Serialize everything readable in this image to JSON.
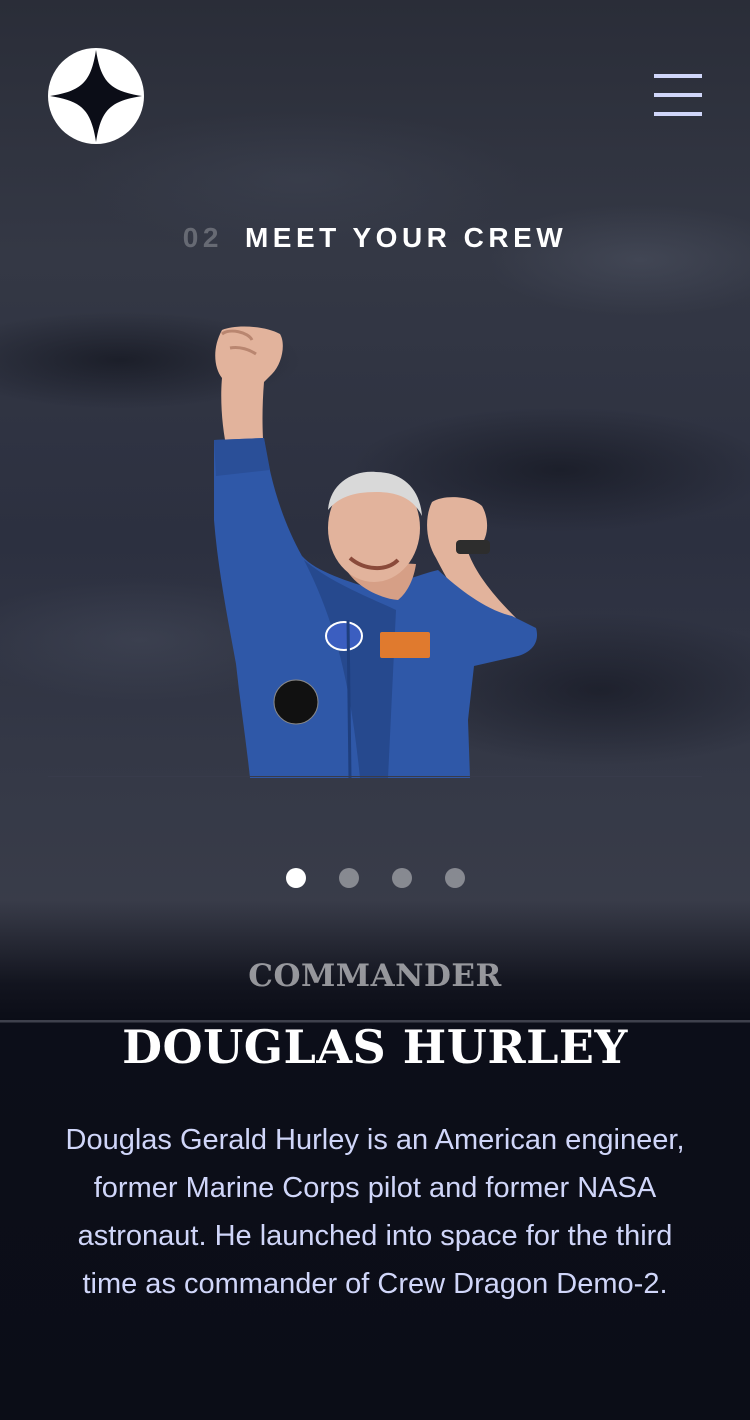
{
  "header": {
    "logo": {
      "icon": "star-logo-icon"
    },
    "menu": {
      "icon": "hamburger-menu-icon"
    }
  },
  "section": {
    "number": "02",
    "title": "MEET YOUR CREW"
  },
  "crew": {
    "image": "astronaut-portrait-douglas-hurley",
    "role": "COMMANDER",
    "name": "DOUGLAS HURLEY",
    "bio": "Douglas Gerald Hurley is an American engineer, former Marine Corps pilot and former NASA astronaut. He launched into space for the third time as commander of Crew Dragon Demo-2."
  },
  "pagination": {
    "count": 4,
    "active_index": 0
  },
  "colors": {
    "background": "#0b0d17",
    "accent": "#d0d6f9",
    "text": "#ffffff"
  }
}
